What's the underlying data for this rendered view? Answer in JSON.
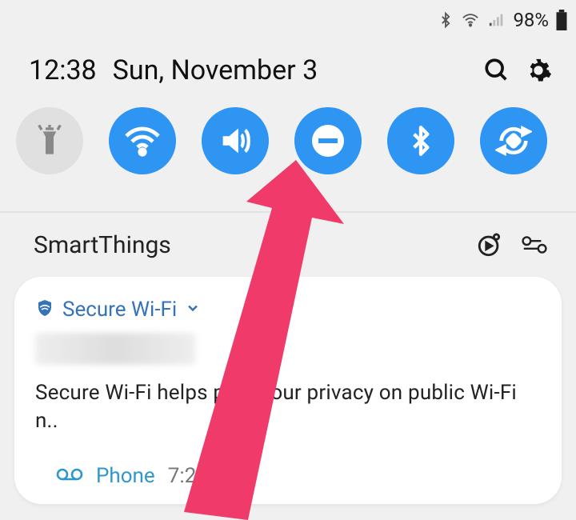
{
  "status_bar": {
    "battery_percent": "98%"
  },
  "panel": {
    "time": "12:38",
    "date": "Sun, November 3"
  },
  "quick_settings": {
    "items": [
      {
        "name": "flashlight",
        "active": false
      },
      {
        "name": "wifi",
        "active": true
      },
      {
        "name": "sound",
        "active": true
      },
      {
        "name": "do-not-disturb",
        "active": true
      },
      {
        "name": "bluetooth",
        "active": true
      },
      {
        "name": "auto-rotate",
        "active": true
      }
    ]
  },
  "smartthings": {
    "title": "SmartThings"
  },
  "notification1": {
    "app_name": "Secure Wi-Fi",
    "body": "Secure Wi-Fi helps pr       ct your privacy on public Wi-Fi n.."
  },
  "notification2": {
    "app_name": "Phone",
    "time": "7:21 AM"
  },
  "colors": {
    "accent": "#2e95f2",
    "arrow": "#ef3a6a"
  }
}
